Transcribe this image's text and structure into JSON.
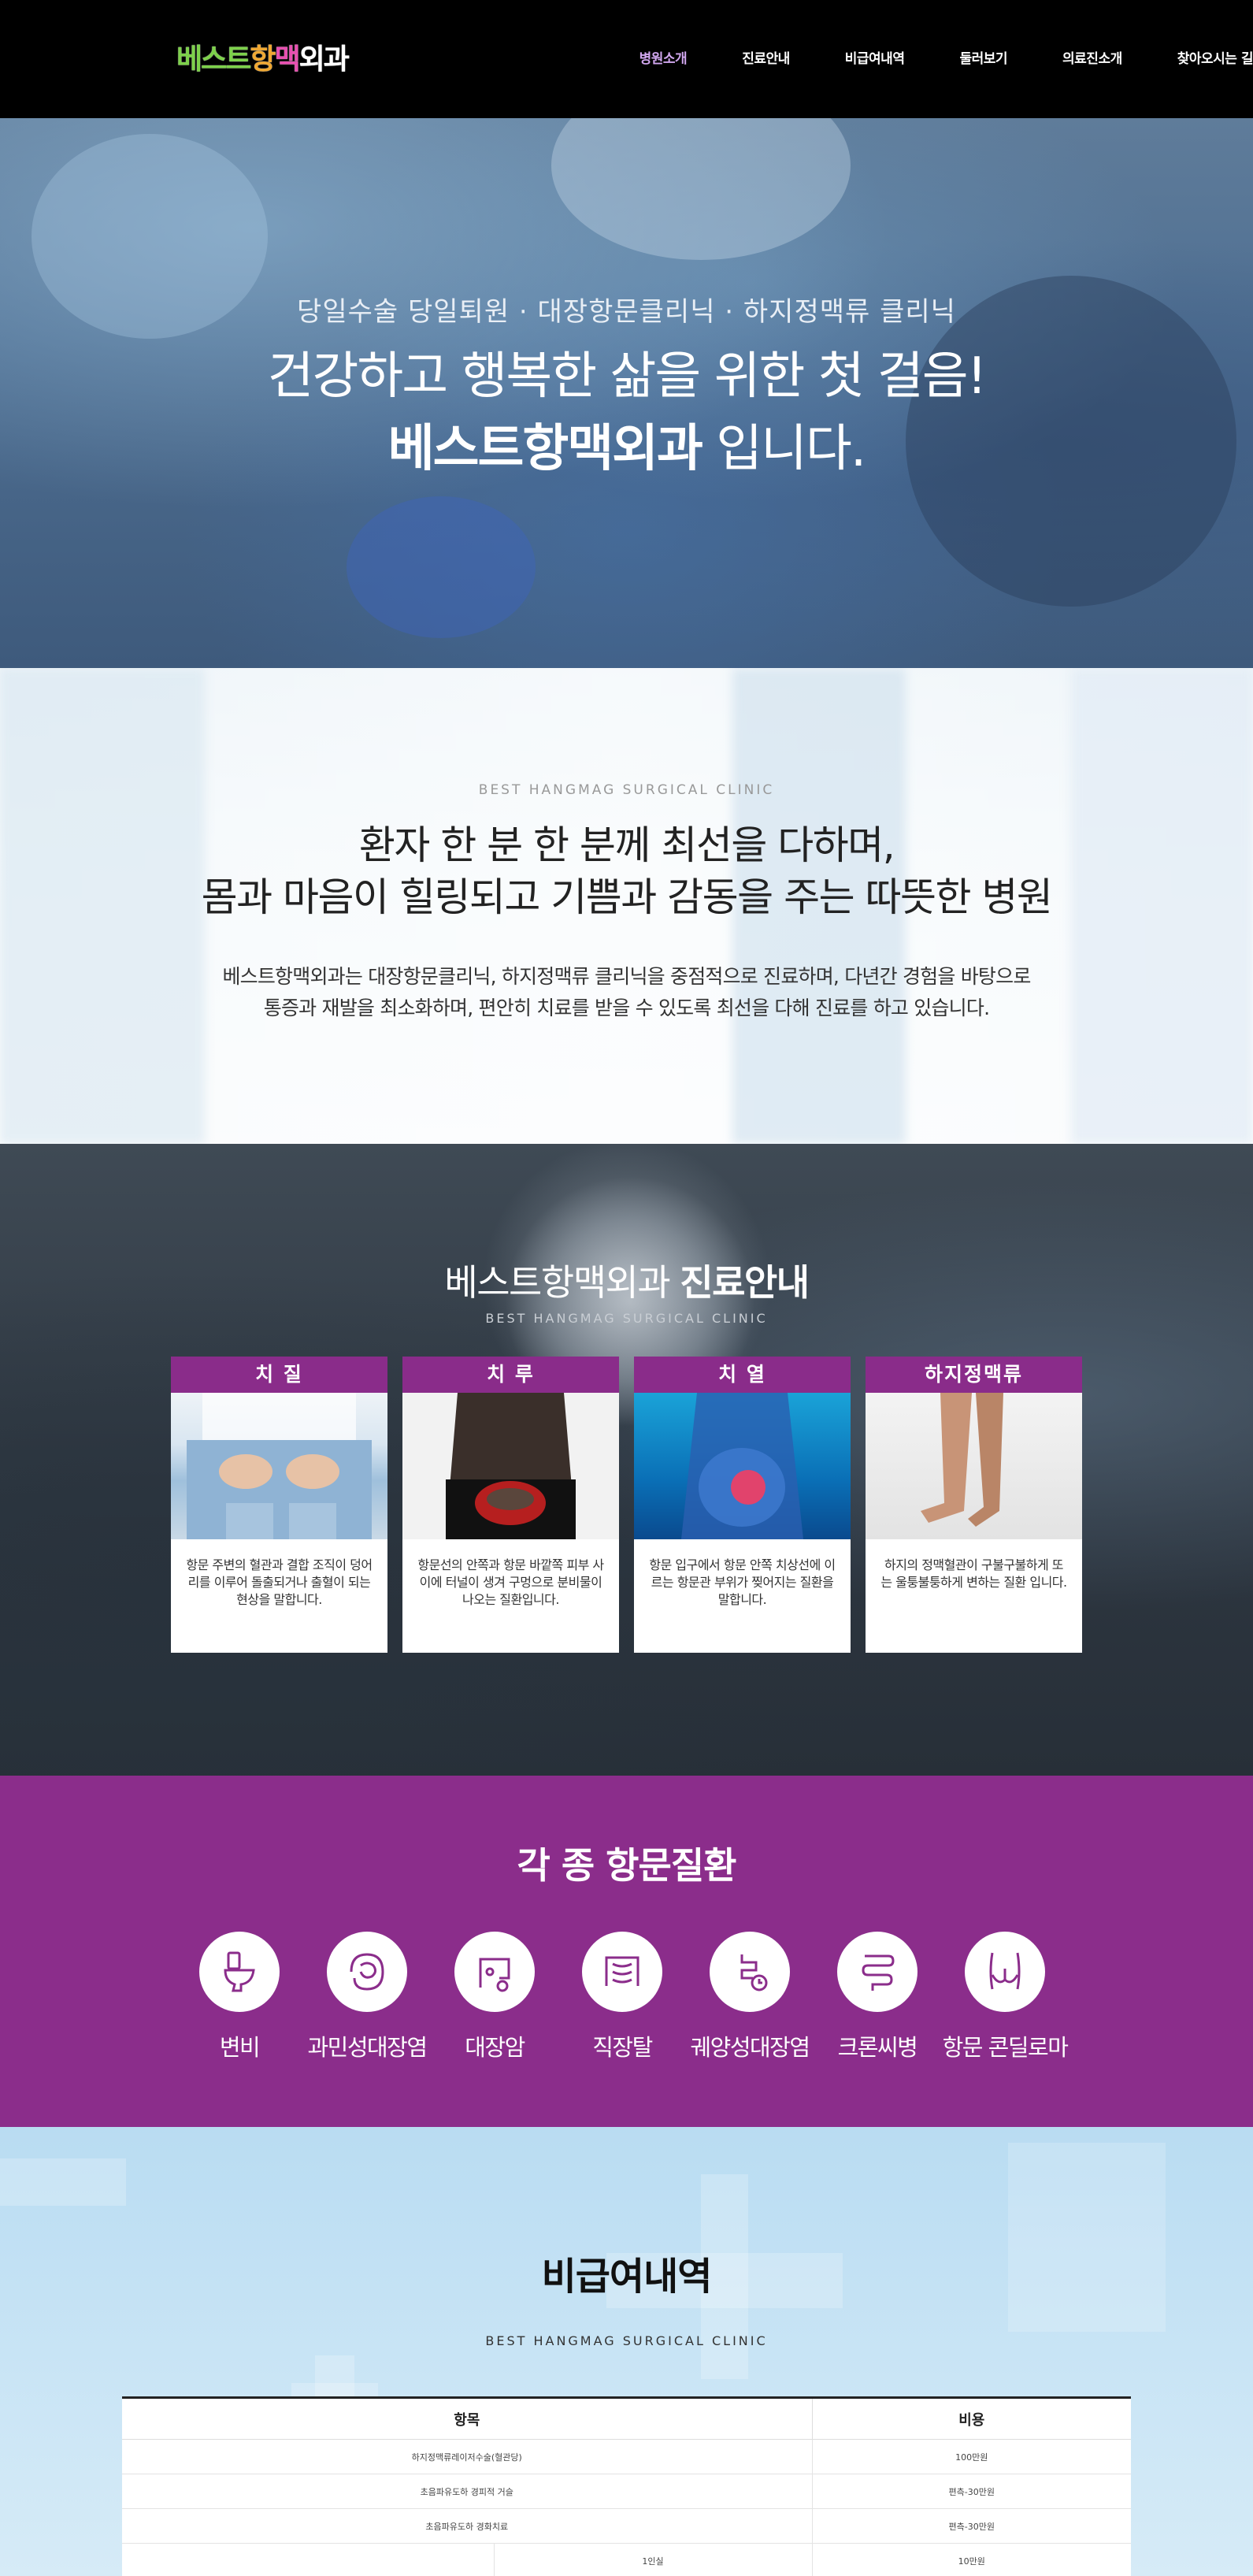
{
  "header": {
    "logo": [
      {
        "text": "베스트",
        "color": "#7dd14a"
      },
      {
        "text": "항",
        "color": "#f0a832"
      },
      {
        "text": "맥",
        "color": "#e84fb0"
      },
      {
        "text": "외과",
        "color": "#ffffff"
      }
    ],
    "nav": [
      {
        "label": "병원소개",
        "active": true
      },
      {
        "label": "진료안내",
        "active": false
      },
      {
        "label": "비급여내역",
        "active": false
      },
      {
        "label": "둘러보기",
        "active": false
      },
      {
        "label": "의료진소개",
        "active": false
      },
      {
        "label": "찾아오시는 길",
        "active": false
      }
    ]
  },
  "hero": {
    "subtitle": "당일수술 당일퇴원 · 대장항문클리닉 · 하지정맥류 클리닉",
    "line1": "건강하고 행복한 삶을 위한 첫 걸음!",
    "brand": "베스트항맥외과",
    "line2_suffix": " 입니다."
  },
  "intro": {
    "eyebrow": "BEST HANGMAG SURGICAL CLINIC",
    "heading1": "환자 한 분 한 분께 최선을 다하며,",
    "heading2": "몸과 마음이 힐링되고 기쁨과 감동을 주는 따뜻한 병원",
    "body1": "베스트항맥외과는 대장항문클리닉, 하지정맥류 클리닉을 중점적으로 진료하며, 다년간 경험을 바탕으로",
    "body2": "통증과 재발을 최소화하며, 편안히 치료를 받을 수 있도록 최선을 다해 진료를 하고 있습니다."
  },
  "treatment": {
    "title_normal": "베스트항맥외과 ",
    "title_bold": "진료안내",
    "subtitle": "BEST HANGMAG SURGICAL CLINIC",
    "cards": [
      {
        "title": "치 질",
        "text": "항문 주변의 혈관과 결합 조직이 덩어리를 이루어 돌출되거나 출혈이 되는 현상을 말합니다."
      },
      {
        "title": "치 루",
        "text": "항문선의 안쪽과 항문 바깥쪽 피부 사이에 터널이 생겨 구멍으로 분비물이 나오는 질환입니다."
      },
      {
        "title": "치 열",
        "text": "항문 입구에서 항문 안쪽 치상선에 이르는 항문관 부위가 찢어지는 질환을 말합니다."
      },
      {
        "title": "하지정맥류",
        "text": "하지의 정맥혈관이 구불구불하게 또는 울퉁불퉁하게 변하는 질환 입니다."
      }
    ]
  },
  "diseases": {
    "title": "각 종 항문질환",
    "items": [
      {
        "label": "변비",
        "icon": "toilet-icon"
      },
      {
        "label": "과민성대장염",
        "icon": "intestine-icon"
      },
      {
        "label": "대장암",
        "icon": "colon-cancer-icon"
      },
      {
        "label": "직장탈",
        "icon": "rectum-icon"
      },
      {
        "label": "궤양성대장염",
        "icon": "ulcer-colon-icon"
      },
      {
        "label": "크론씨병",
        "icon": "crohn-icon"
      },
      {
        "label": "항문 콘딜로마",
        "icon": "buttocks-icon"
      }
    ]
  },
  "pricing": {
    "title": "비급여내역",
    "subtitle": "BEST HANGMAG SURGICAL CLINIC",
    "headers": [
      "항목",
      "비용"
    ],
    "rows": [
      {
        "item": "하지정맥류레이저수술(혈관당)",
        "cost": "100만원"
      },
      {
        "item": "초음파유도하 경피적 거슬",
        "cost": "편측-30만원"
      },
      {
        "item": "초음파유도하 경화치료",
        "cost": "편측-30만원"
      },
      {
        "item_sub": "1인실",
        "cost": "10만원"
      }
    ]
  }
}
